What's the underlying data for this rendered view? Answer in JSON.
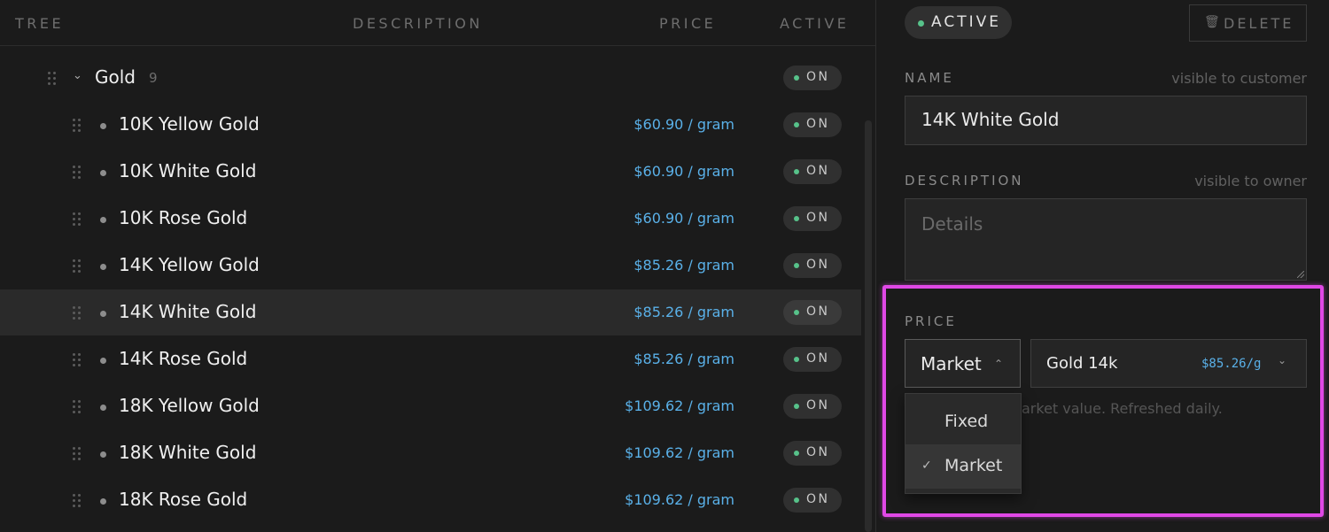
{
  "tree": {
    "columns": {
      "tree": "TREE",
      "description": "DESCRIPTION",
      "price": "PRICE",
      "active": "ACTIVE"
    },
    "group": {
      "name": "Gold",
      "count": "9",
      "toggle": "ON"
    },
    "items": [
      {
        "name": "10K Yellow Gold",
        "price": "$60.90 / gram",
        "toggle": "ON"
      },
      {
        "name": "10K White Gold",
        "price": "$60.90 / gram",
        "toggle": "ON"
      },
      {
        "name": "10K Rose Gold",
        "price": "$60.90 / gram",
        "toggle": "ON"
      },
      {
        "name": "14K Yellow Gold",
        "price": "$85.26 / gram",
        "toggle": "ON"
      },
      {
        "name": "14K White Gold",
        "price": "$85.26 / gram",
        "toggle": "ON",
        "selected": true
      },
      {
        "name": "14K Rose Gold",
        "price": "$85.26 / gram",
        "toggle": "ON"
      },
      {
        "name": "18K Yellow Gold",
        "price": "$109.62 / gram",
        "toggle": "ON"
      },
      {
        "name": "18K White Gold",
        "price": "$109.62 / gram",
        "toggle": "ON"
      },
      {
        "name": "18K Rose Gold",
        "price": "$109.62 / gram",
        "toggle": "ON"
      }
    ]
  },
  "detail": {
    "status": "ACTIVE",
    "delete_label": "DELETE",
    "name_label": "NAME",
    "name_hint": "visible to customer",
    "name_value": "14K White Gold",
    "description_label": "DESCRIPTION",
    "description_hint": "visible to owner",
    "description_placeholder": "Details",
    "price_label": "PRICE",
    "price_mode": "Market",
    "price_source": "Gold 14k",
    "price_rate": "$85.26/g",
    "price_helper": "arket value. Refreshed daily.",
    "price_mode_options": [
      {
        "label": "Fixed",
        "selected": false
      },
      {
        "label": "Market",
        "selected": true
      }
    ]
  },
  "colors": {
    "accent_price": "#5ab1e9",
    "status_on": "#57c28a",
    "highlight": "#e048e6"
  }
}
